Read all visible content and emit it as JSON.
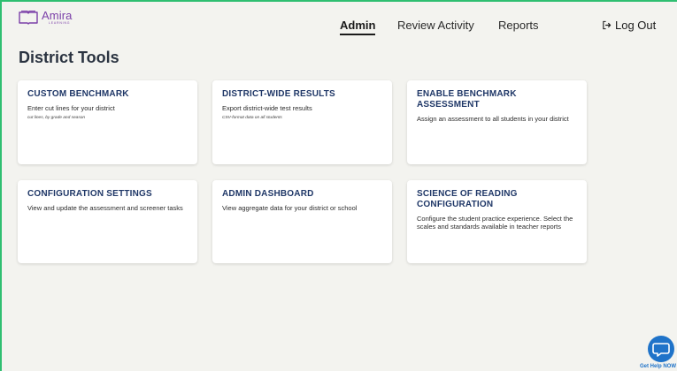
{
  "app": {
    "logo_text": "Amira",
    "logo_subtext": "LEARNING",
    "brand_color": "#7b3fa8",
    "accent_border_color": "#2fbf71"
  },
  "nav": {
    "items": [
      {
        "label": "Admin",
        "active": true
      },
      {
        "label": "Review Activity",
        "active": false
      },
      {
        "label": "Reports",
        "active": false
      }
    ],
    "logout_label": "Log Out",
    "logout_icon": "logout-arrow-icon"
  },
  "page": {
    "title": "District Tools"
  },
  "cards": [
    {
      "title": "CUSTOM BENCHMARK",
      "description": "Enter cut lines for your district",
      "note": "cut lines, by grade and season"
    },
    {
      "title": "DISTRICT-WIDE RESULTS",
      "description": "Export district-wide test results",
      "note": "CSV-format data on all students"
    },
    {
      "title": "ENABLE BENCHMARK ASSESSMENT",
      "description": "Assign an assessment to all students in your district",
      "note": ""
    },
    {
      "title": "CONFIGURATION SETTINGS",
      "description": "View and update the assessment and screener tasks",
      "note": ""
    },
    {
      "title": "ADMIN DASHBOARD",
      "description": "View aggregate data for your district or school",
      "note": ""
    },
    {
      "title": "SCIENCE OF READING CONFIGURATION",
      "description": "Configure the student practice experience. Select the scales and standards available in teacher reports",
      "note": ""
    }
  ],
  "help": {
    "label": "Get Help NOW",
    "icon": "chat-bubble-icon",
    "color": "#1f73c9"
  }
}
